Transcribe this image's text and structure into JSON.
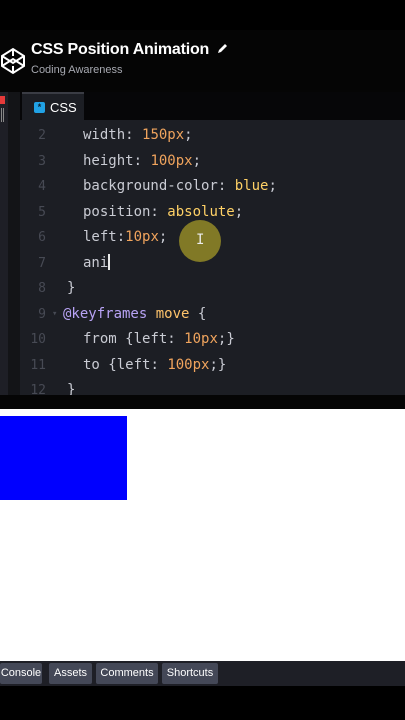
{
  "header": {
    "title": "CSS Position Animation",
    "subtitle": "Coding Awareness"
  },
  "editor": {
    "tab_label": "CSS",
    "lines": [
      {
        "num": "2",
        "tokens": [
          [
            "prop",
            "width: "
          ],
          [
            "num",
            "150px"
          ],
          [
            "punc",
            ";"
          ]
        ]
      },
      {
        "num": "3",
        "tokens": [
          [
            "prop",
            "height: "
          ],
          [
            "num",
            "100px"
          ],
          [
            "punc",
            ";"
          ]
        ]
      },
      {
        "num": "4",
        "tokens": [
          [
            "prop",
            "background-color: "
          ],
          [
            "val",
            "blue"
          ],
          [
            "punc",
            ";"
          ]
        ]
      },
      {
        "num": "5",
        "tokens": [
          [
            "prop",
            "position: "
          ],
          [
            "val",
            "absolute"
          ],
          [
            "punc",
            ";"
          ]
        ]
      },
      {
        "num": "6",
        "tokens": [
          [
            "prop",
            "left:"
          ],
          [
            "num",
            "10px"
          ],
          [
            "punc",
            ";"
          ]
        ]
      },
      {
        "num": "7",
        "tokens": [
          [
            "prop",
            "ani"
          ]
        ]
      },
      {
        "num": "8",
        "tokens": [
          [
            "punc",
            "}"
          ]
        ]
      },
      {
        "num": "9",
        "tokens": [
          [
            "kw",
            "@keyframes "
          ],
          [
            "str",
            "move"
          ],
          [
            "punc",
            " {"
          ]
        ]
      },
      {
        "num": "10",
        "tokens": [
          [
            "prop",
            "from "
          ],
          [
            "punc",
            "{"
          ],
          [
            "prop",
            "left: "
          ],
          [
            "num",
            "10px"
          ],
          [
            "punc",
            ";}"
          ]
        ]
      },
      {
        "num": "11",
        "tokens": [
          [
            "prop",
            "to "
          ],
          [
            "punc",
            "{"
          ],
          [
            "prop",
            "left: "
          ],
          [
            "num",
            "100px"
          ],
          [
            "punc",
            ";}"
          ]
        ]
      },
      {
        "num": "12",
        "tokens": [
          [
            "punc",
            "}"
          ]
        ]
      }
    ]
  },
  "bottom_bar": {
    "console": "Console",
    "assets": "Assets",
    "comments": "Comments",
    "shortcuts": "Shortcuts"
  },
  "colors": {
    "preview_box": "#0000ff",
    "tab_icon": "#21a2e6",
    "cursor_highlight": "#d6c428"
  },
  "icons": [
    "codepen-logo-icon",
    "pencil-icon",
    "css-tab-icon",
    "fold-arrow-icon",
    "text-cursor-icon"
  ]
}
